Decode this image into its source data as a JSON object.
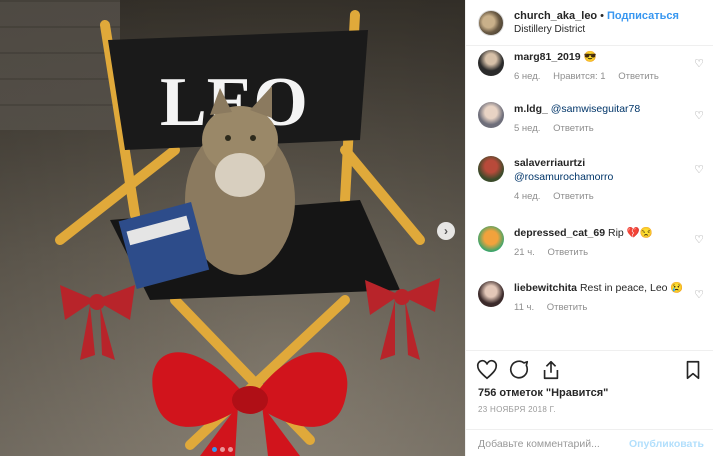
{
  "post": {
    "username": "church_aka_leo",
    "separator": "•",
    "follow_label": "Подписаться",
    "location": "Distillery District",
    "chair_text": "LEO"
  },
  "comments": [
    {
      "username": "marg81_2019",
      "text": "😎",
      "time": "6 нед.",
      "likes": "Нравится: 1",
      "reply": "Ответить"
    },
    {
      "username": "m.ldg_",
      "mention": "@samwiseguitar78",
      "text": "",
      "time": "5 нед.",
      "reply": "Ответить"
    },
    {
      "username": "salaverriaurtzi",
      "mention": "@rosamurochamorro",
      "text": "",
      "time": "4 нед.",
      "reply": "Ответить"
    },
    {
      "username": "depressed_cat_69",
      "text": "Rip 💔😒",
      "time": "21 ч.",
      "reply": "Ответить"
    },
    {
      "username": "liebewitchita",
      "text": "Rest in peace, Leo 😢",
      "time": "11 ч.",
      "reply": "Ответить"
    }
  ],
  "actions": {
    "likes_text": "756 отметок \"Нравится\"",
    "date": "23 НОЯБРЯ 2018 Г.",
    "comment_placeholder": "Добавьте комментарий...",
    "publish_label": "Опубликовать"
  },
  "icons": {
    "like": "heart-icon",
    "comment": "comment-icon",
    "share": "share-icon",
    "save": "bookmark-icon",
    "next": "chevron-right-icon"
  },
  "colors": {
    "accent": "#3897f0",
    "publish_disabled": "#b2dffc",
    "muted": "#8e8e8e"
  }
}
